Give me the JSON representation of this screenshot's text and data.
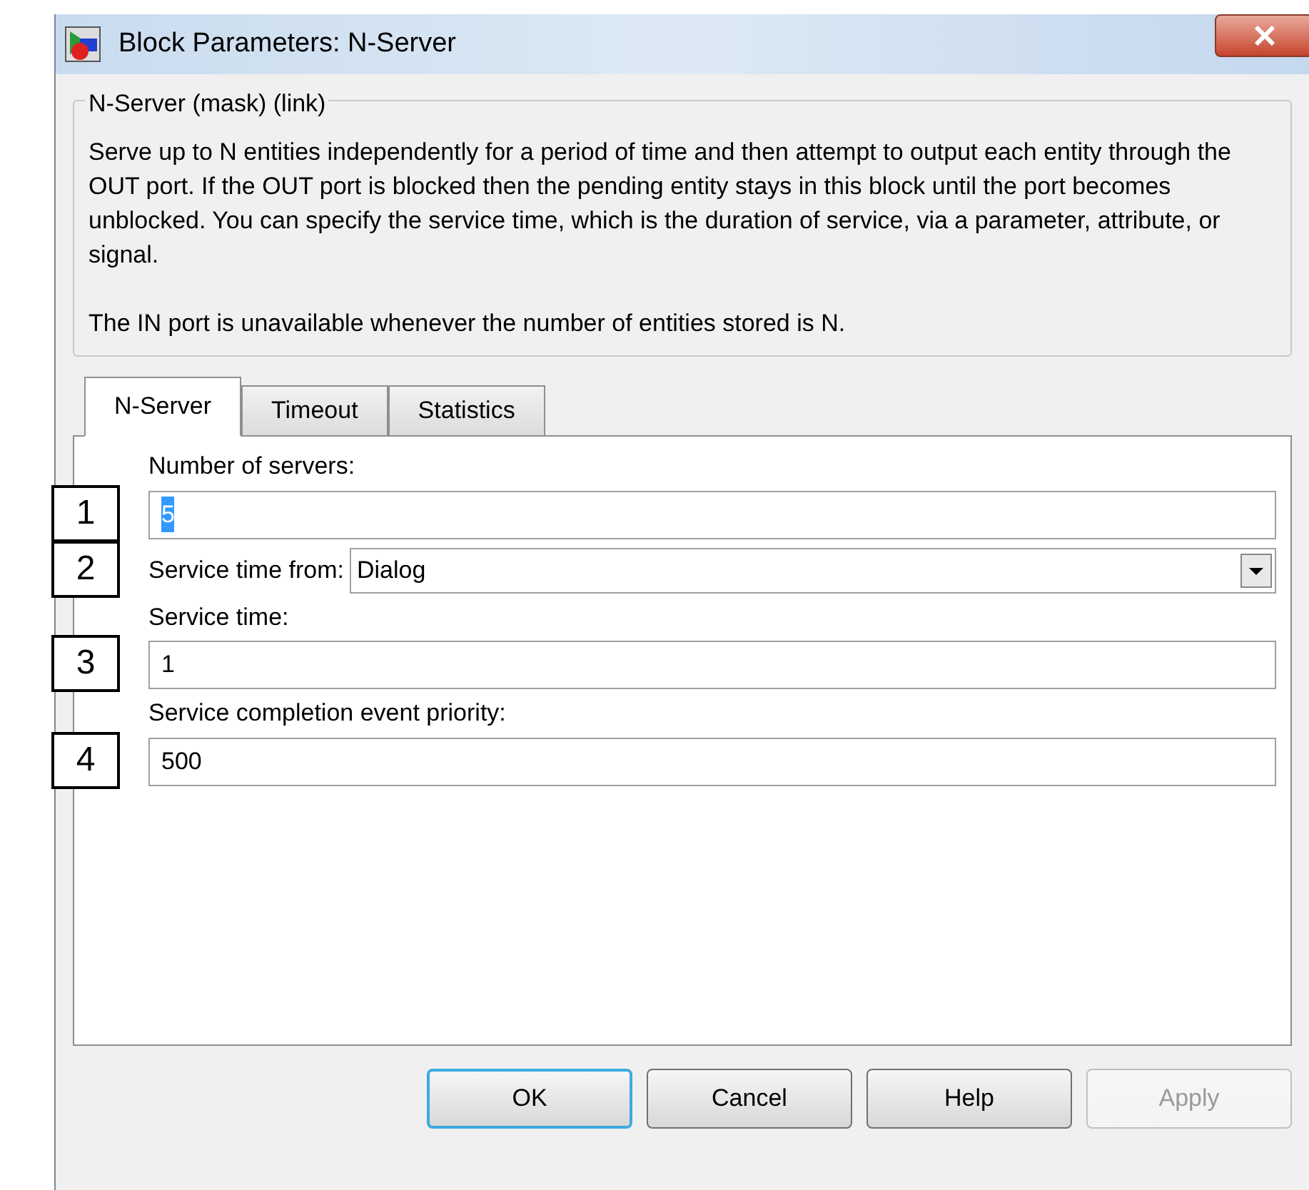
{
  "window": {
    "title": "Block Parameters: N-Server"
  },
  "group": {
    "title": "N-Server (mask) (link)",
    "paragraphs": [
      "Serve up to N entities independently for a period of time and then attempt to output each entity through the OUT port. If the OUT port is blocked then the pending entity stays in this block until the port becomes unblocked. You can specify the service time, which is the duration of service, via a parameter, attribute, or signal.",
      "The IN port is unavailable whenever the number of entities stored is N."
    ]
  },
  "tabs": [
    {
      "label": "N-Server",
      "selected": true
    },
    {
      "label": "Timeout",
      "selected": false
    },
    {
      "label": "Statistics",
      "selected": false
    }
  ],
  "fields": [
    {
      "kind": "text",
      "label": "Number of servers:",
      "value": "5",
      "value_selected": true,
      "callout": "1"
    },
    {
      "kind": "dropdown",
      "label": "Service time from:",
      "value": "Dialog",
      "value_selected": false,
      "callout": "2"
    },
    {
      "kind": "text",
      "label": "Service time:",
      "value": "1",
      "value_selected": false,
      "callout": "3"
    },
    {
      "kind": "text",
      "label": "Service completion event priority:",
      "value": "500",
      "value_selected": false,
      "callout": "4"
    }
  ],
  "buttons": [
    {
      "label": "OK",
      "default": true,
      "disabled": false
    },
    {
      "label": "Cancel",
      "default": false,
      "disabled": false
    },
    {
      "label": "Help",
      "default": false,
      "disabled": false
    },
    {
      "label": "Apply",
      "default": false,
      "disabled": true
    }
  ]
}
